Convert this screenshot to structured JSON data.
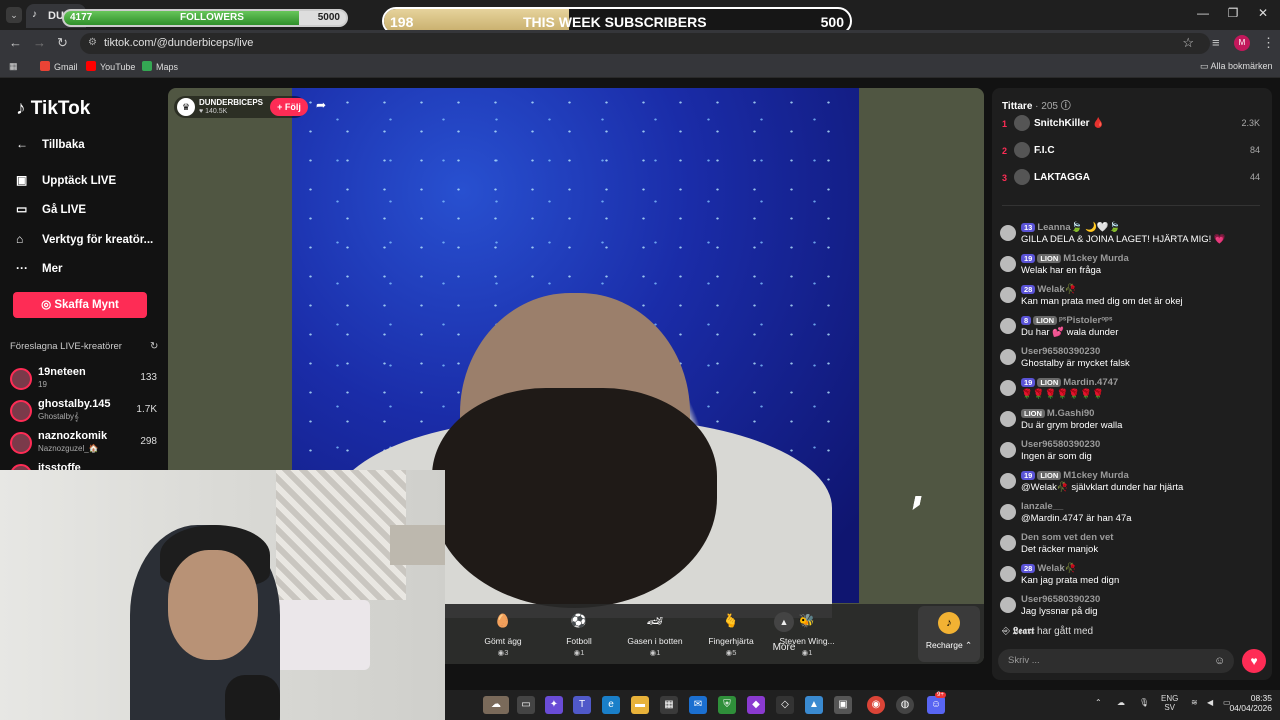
{
  "browser": {
    "tab_title": "DUNDER",
    "url": "tiktok.com/@dunderbiceps/live",
    "bookmarks": [
      {
        "label": "Gmail",
        "color": "#ea4335"
      },
      {
        "label": "YouTube",
        "color": "#ff0000"
      },
      {
        "label": "Maps",
        "color": "#34a853"
      }
    ],
    "all_bookmarks": "Alla bokmärken",
    "profile_initial": "M"
  },
  "overlay": {
    "followers_current": "4177",
    "followers_label": "FOLLOWERS",
    "followers_goal": "5000",
    "followers_progress": 0.835,
    "subs_current": "198",
    "subs_label": "THIS WEEK SUBSCRIBERS",
    "subs_goal": "500",
    "subs_progress": 0.396
  },
  "sidebar": {
    "logo": "TikTok",
    "back": "Tillbaka",
    "items": [
      {
        "label": "Upptäck LIVE",
        "icon": "live-tv-icon"
      },
      {
        "label": "Gå LIVE",
        "icon": "camera-icon"
      },
      {
        "label": "Verktyg för kreatör...",
        "icon": "creator-tools-icon"
      },
      {
        "label": "Mer",
        "icon": "more-dots-icon"
      }
    ],
    "coins_button": "Skaffa Mynt",
    "suggested_title": "Föreslagna LIVE-kreatörer",
    "creators": [
      {
        "name": "19neteen",
        "sub": "19",
        "count": "133"
      },
      {
        "name": "ghostalby.145",
        "sub": "Ghostalby𝄞",
        "count": "1.7K"
      },
      {
        "name": "naznozkomik",
        "sub": "Naznozguzel_🏠",
        "count": "298"
      },
      {
        "name": "itsstoffe",
        "sub": "",
        "count": ""
      }
    ]
  },
  "stream": {
    "host_name": "DUNDERBICEPS",
    "host_likes": "140.5K",
    "follow": "+ Följ",
    "gifts": [
      {
        "label": "Gömt ägg",
        "price": "3",
        "icon": "🥚"
      },
      {
        "label": "Fotboll",
        "price": "1",
        "icon": "⚽"
      },
      {
        "label": "Gasen i botten",
        "price": "1",
        "icon": "🏎"
      },
      {
        "label": "Fingerhjärta",
        "price": "5",
        "icon": "🫰"
      },
      {
        "label": "Steven Wing...",
        "price": "1",
        "icon": "🐝"
      }
    ],
    "more": "More",
    "recharge": "Recharge"
  },
  "chat": {
    "viewers_title": "Tittare",
    "viewers_count": "· 205",
    "top_viewers": [
      {
        "rank": "1",
        "name": "SnitchKiller 🩸",
        "value": "2.3K"
      },
      {
        "rank": "2",
        "name": "F.I.C",
        "value": "84"
      },
      {
        "rank": "3",
        "name": "LAKTAGGA",
        "value": "44"
      }
    ],
    "messages": [
      {
        "badge": "13",
        "lion": "",
        "user": "Leanna🍃 🌙🤍🍃",
        "text": "GILLA DELA & JOINA LAGET! HJÄRTA MIG! 💗"
      },
      {
        "badge": "19",
        "lion": "LION",
        "user": "M1ckey Murda",
        "text": "Welak har en fråga"
      },
      {
        "badge": "28",
        "lion": "",
        "user": "Welak🥀",
        "text": "Kan man prata med dig om det är okej"
      },
      {
        "badge": "8",
        "lion": "LION",
        "user": "ᵖˢPistolerᵒᵖˢ",
        "text": "Du har 💕 wala dunder"
      },
      {
        "badge": "",
        "lion": "",
        "user": "User96580390230",
        "text": "Ghostalby är mycket falsk"
      },
      {
        "badge": "19",
        "lion": "LION",
        "user": "Mardin.4747",
        "text": "🌹🌹🌹🌹🌹🌹🌹"
      },
      {
        "badge": "",
        "lion": "LION",
        "user": "M.Gashi90",
        "text": "Du är grym broder walla"
      },
      {
        "badge": "",
        "lion": "",
        "user": "User96580390230",
        "text": "Ingen är som dig"
      },
      {
        "badge": "19",
        "lion": "LION",
        "user": "M1ckey Murda",
        "text": "@Welak🥀 självklart dunder har hjärta"
      },
      {
        "badge": "",
        "lion": "",
        "user": "lanzale__",
        "text": "@Mardin.4747 är han 47a"
      },
      {
        "badge": "",
        "lion": "",
        "user": "Den som vet den vet",
        "text": "Det räcker manjok"
      },
      {
        "badge": "28",
        "lion": "",
        "user": "Welak🥀",
        "text": "Kan jag prata med dign"
      },
      {
        "badge": "",
        "lion": "",
        "user": "User96580390230",
        "text": "Jag lyssnar på dig"
      }
    ],
    "joined_user": "𝕷𝖊𝖆𝖗𝖙",
    "joined_text": "har gått med",
    "input_placeholder": "Skriv ..."
  },
  "taskbar": {
    "lang": "ENG",
    "lang_sub": "SV",
    "time": "08:35",
    "date": "04/04/2026",
    "notif": "9+"
  }
}
